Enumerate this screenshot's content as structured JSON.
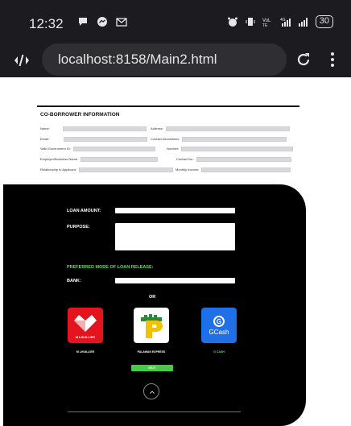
{
  "status_bar": {
    "time": "12:32",
    "battery": "30",
    "left_icons": [
      "chat-bubble-icon",
      "messenger-icon",
      "gmail-icon"
    ],
    "right_icons": [
      "alarm-icon",
      "vibrate-icon",
      "volte-icon",
      "4g-signal-icon",
      "signal-icon",
      "battery-icon"
    ]
  },
  "browser": {
    "url": "localhost:8158/Main2.html"
  },
  "co_borrower": {
    "title": "CO-BORROWER INFORMATION",
    "fields": {
      "name": "Name:",
      "address": "Address:",
      "email": "Email:",
      "contact_info": "Contact Information:",
      "gov_id": "Valid Government ID:",
      "number": "Number:",
      "employer": "Employer/Business Name:",
      "contact_no": "Contact No.:",
      "relationship": "Relationship to Applicant:",
      "monthly_income": "Monthly Income:"
    }
  },
  "loan": {
    "amount_label": "LOAN AMOUNT:",
    "purpose_label": "PURPOSE:",
    "release_label": "PREFERRED MODE OF LOAN RELEASE:",
    "bank_label": "BANK:",
    "or_label": "OR",
    "options": [
      {
        "name": "M LHUILLIER",
        "caption_color": "#ffffff"
      },
      {
        "name": "PALAWAN EXPRESS",
        "caption_color": "#ffffff"
      },
      {
        "name": "G CASH",
        "caption_color": "#53e653"
      }
    ],
    "gcash_logo_text": "GCash",
    "ml_logo_text": "M LHUILLIER",
    "next_label": "NEXT"
  },
  "colors": {
    "accent_green": "#53e653",
    "gcash_blue": "#1e6fe8",
    "ml_red": "#e3141d",
    "palawan_yellow": "#f2c200",
    "palawan_green": "#2a8a3a"
  }
}
